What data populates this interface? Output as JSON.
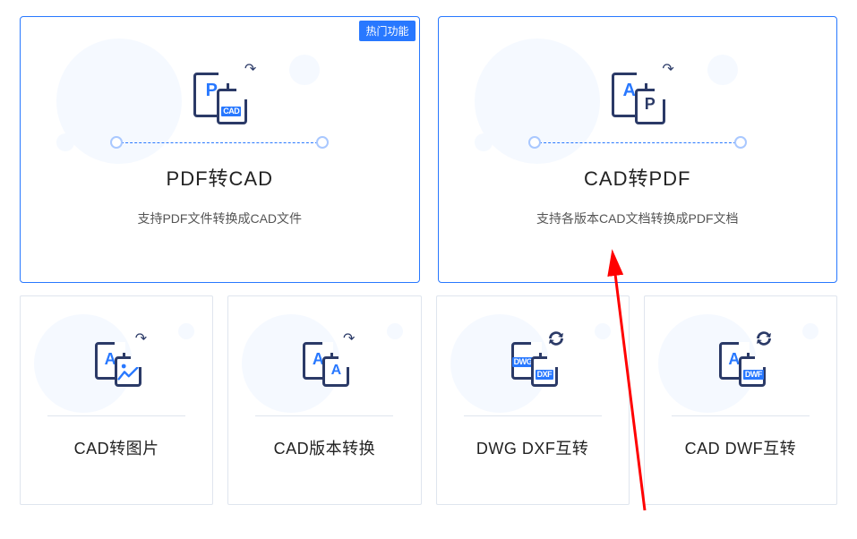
{
  "badge_hot": "热门功能",
  "top_cards": [
    {
      "title": "PDF转CAD",
      "desc": "支持PDF文件转换成CAD文件",
      "icon_back_letter": "P",
      "icon_back_letter_color": "#2878ff",
      "icon_front_tag": "CAD",
      "hot": true
    },
    {
      "title": "CAD转PDF",
      "desc": "支持各版本CAD文档转换成PDF文档",
      "icon_back_letter": "A",
      "icon_back_letter_color": "#2878ff",
      "icon_front_letter": "P",
      "icon_front_letter_color": "#2b3a67",
      "hot": false
    }
  ],
  "bot_cards": [
    {
      "title": "CAD转图片",
      "icon_back_letter": "A",
      "icon_back_letter_color": "#2878ff",
      "icon_front_kind": "image"
    },
    {
      "title": "CAD版本转换",
      "icon_back_letter": "A",
      "icon_back_letter_color": "#2878ff",
      "icon_front_letter": "A",
      "icon_front_letter_color": "#2878ff"
    },
    {
      "title": "DWG DXF互转",
      "icon_back_tag": "DWG",
      "icon_front_tag": "DXF",
      "rotate": true
    },
    {
      "title": "CAD DWF互转",
      "icon_back_letter": "A",
      "icon_back_letter_color": "#2878ff",
      "icon_front_tag": "DWF",
      "rotate": true
    }
  ]
}
